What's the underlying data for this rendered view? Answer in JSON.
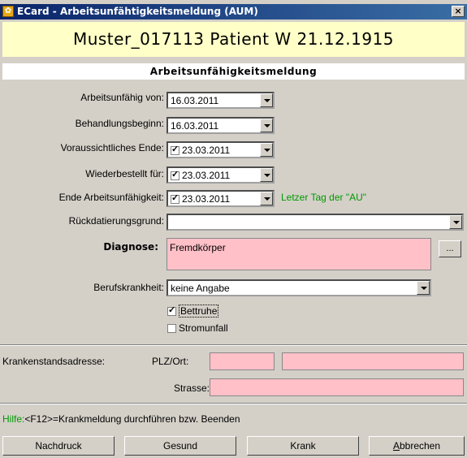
{
  "window": {
    "title": "ECard - Arbeitsunfähtigkeitsmeldung (AUM)",
    "close_label": "×"
  },
  "patient": {
    "banner": "Muster_017113 Patient W 21.12.1915"
  },
  "section": {
    "title": "Arbeitsunfähigkeitsmeldung"
  },
  "fields": {
    "arbeitsunfaehig_von": {
      "label": "Arbeitsunfähig von:",
      "value": "16.03.2011"
    },
    "behandlungsbeginn": {
      "label": "Behandlungsbeginn:",
      "value": "16.03.2011"
    },
    "voraussichtliches_ende": {
      "label": "Voraussichtliches Ende:",
      "value": "23.03.2011",
      "checked": true
    },
    "wiederbestellt_fuer": {
      "label": "Wiederbestellt für:",
      "value": "23.03.2011",
      "checked": true
    },
    "ende_arbeitsunfaehigkeit": {
      "label": "Ende Arbeitsunfähigkeit:",
      "value": "23.03.2011",
      "checked": true,
      "hint": "Letzer Tag der \"AU\""
    },
    "rueckdatierungsgrund": {
      "label": "Rückdatierungsgrund:",
      "value": ""
    },
    "diagnose": {
      "label": "Diagnose:",
      "value": "Fremdkörper",
      "more_label": "..."
    },
    "berufskrankheit": {
      "label": "Berufskrankheit:",
      "value": "keine Angabe"
    },
    "bettruhe": {
      "label": "Bettruhe",
      "checked": true
    },
    "stromunfall": {
      "label": "Stromunfall",
      "checked": false
    }
  },
  "address": {
    "label": "Krankenstandsadresse:",
    "plz_label": "PLZ/Ort:",
    "plz_value": "",
    "ort_value": "",
    "strasse_label": "Strasse:",
    "strasse_value": ""
  },
  "help": {
    "text": "Hilfe:<F12>=Krankmeldung durchführen bzw. Beenden",
    "prefix": "Hilfe:",
    "rest": "<F12>=Krankmeldung durchführen bzw. Beenden"
  },
  "buttons": {
    "nachdruck": "Nachdruck",
    "gesund": "Gesund",
    "krank": "Krank",
    "abbrechen_first": "A",
    "abbrechen_rest": "bbrechen"
  },
  "colors": {
    "title_bar": "#0a246a",
    "banner_bg": "#ffffc8",
    "required_bg": "#ffc0c8",
    "hint_green": "#009900"
  }
}
